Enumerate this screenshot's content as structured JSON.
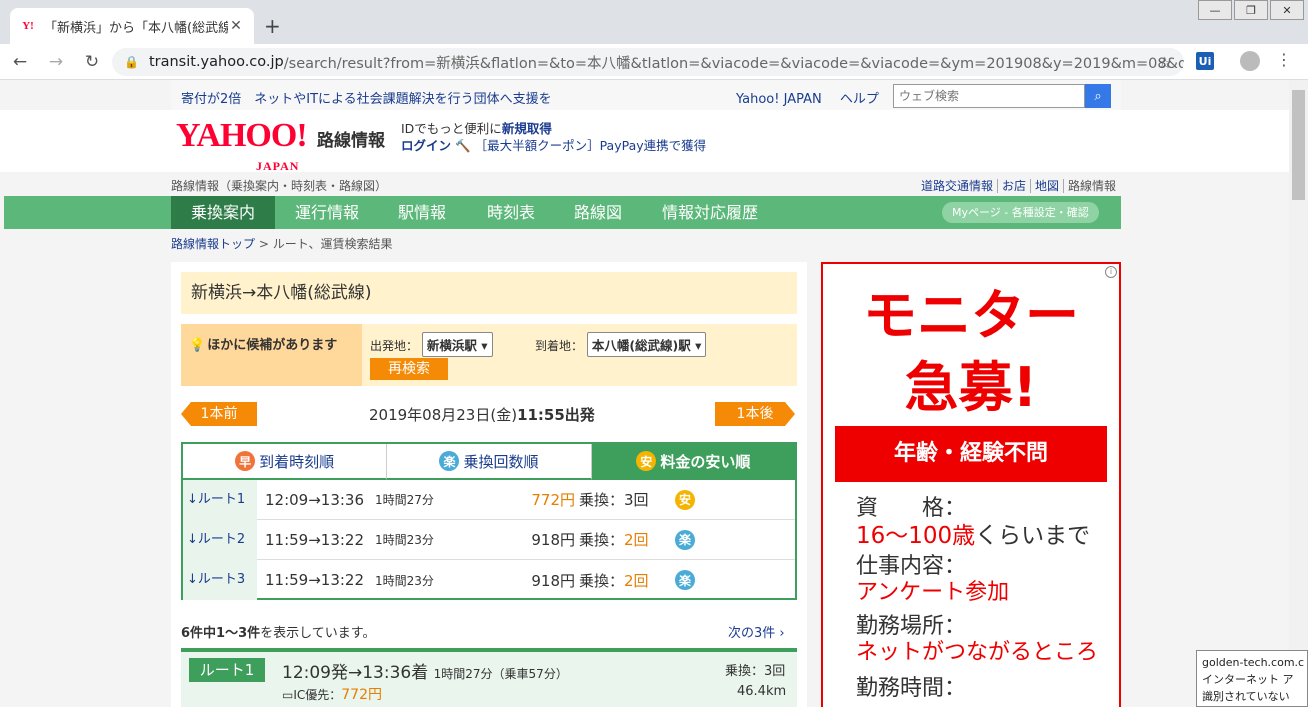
{
  "browser": {
    "tab_title": "「新横浜」から「本八幡(総武線",
    "tab_favicon": "Y!",
    "url_host": "transit.yahoo.co.jp",
    "url_path": "/search/result?from=新横浜&flatlon=&to=本八幡&tlatlon=&viacode=&viacode=&viacode=&ym=201908&y=2019&m=08&d=…",
    "ext_label": "Ui"
  },
  "header": {
    "donation": "寄付が2倍　ネットやITによる社会課題解決を行う団体へ支援を",
    "yahoo_japan": "Yahoo! JAPAN",
    "help": "ヘルプ",
    "search_placeholder": "ウェブ検索",
    "logo_main": "YAHOO!",
    "logo_sub": "JAPAN",
    "logo_title": "路線情報",
    "id_line1_a": "IDでもっと便利に",
    "id_line1_b": "新規取得",
    "id_login": "ログイン",
    "id_coupon": "［最大半額クーポン］PayPay連携で獲得"
  },
  "subbar": {
    "left": "路線情報（乗換案内・時刻表・路線図）",
    "links": [
      "道路交通情報",
      "お店",
      "地図",
      "路線情報"
    ]
  },
  "nav": {
    "items": [
      "乗換案内",
      "運行情報",
      "駅情報",
      "時刻表",
      "路線図",
      "情報対応履歴"
    ],
    "mypage": "Myページ - 各種設定・確認"
  },
  "breadcrumb": {
    "link": "路線情報トップ",
    "current": " > ルート、運賃検索結果"
  },
  "search": {
    "title": "新横浜→本八幡(総武線)",
    "candidates_label": "ほかに候補があります",
    "from_label": "出発地：",
    "from_value": "新横浜駅",
    "to_label": "到着地：",
    "to_value": "本八幡(総武線)駅",
    "research": "再検索",
    "prev": "1本前",
    "next": "1本後",
    "date": "2019年08月23日(金)",
    "time": "11:55出発"
  },
  "sort": {
    "tabs": [
      {
        "icon": "早",
        "label": "到着時刻順"
      },
      {
        "icon": "楽",
        "label": "乗換回数順"
      },
      {
        "icon": "安",
        "label": "料金の安い順"
      }
    ]
  },
  "routes": [
    {
      "label": "↓ルート1",
      "time": "12:09→13:36",
      "duration": "1時間27分",
      "fare": "772円",
      "transfer_label": "乗換：",
      "transfer_count": "3回",
      "badge": "安"
    },
    {
      "label": "↓ルート2",
      "time": "11:59→13:22",
      "duration": "1時間23分",
      "fare": "918円",
      "transfer_label": "乗換：",
      "transfer_count": "2回",
      "badge": "楽"
    },
    {
      "label": "↓ルート3",
      "time": "11:59→13:22",
      "duration": "1時間23分",
      "fare": "918円",
      "transfer_label": "乗換：",
      "transfer_count": "2回",
      "badge": "楽"
    }
  ],
  "results": {
    "summary_a": "6件中",
    "summary_b": "1～3件",
    "summary_c": "を表示しています。",
    "next_page": "次の3件"
  },
  "detail": {
    "label": "ルート1",
    "time": "12:09発→13:36着",
    "duration": "1時間27分（乗車57分）",
    "transfer": "乗換：3回",
    "ic_label": "IC優先：",
    "ic_fare": "772円",
    "distance": "46.4km"
  },
  "ad": {
    "line1": "モニター",
    "line2": "急募!",
    "band": "年齢・経験不問",
    "q1": "資　　格：",
    "a1_red": "16～100歳",
    "a1_rest": "くらいまで",
    "q2": "仕事内容：",
    "a2": "アンケート参加",
    "q3": "勤務場所：",
    "a3": "ネットがつながるところ",
    "q4": "勤務時間："
  },
  "tooltip": {
    "line1": "golden-tech.com.c",
    "line2": "インターネット ア",
    "line3": "識別されていない"
  },
  "colors": {
    "green": "#5cb87a",
    "dark_green": "#2e7d48",
    "orange": "#f58a07",
    "yahoo_red": "#ff0033",
    "ad_red": "#e00000"
  }
}
